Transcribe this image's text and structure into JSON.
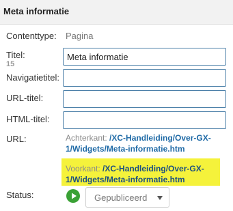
{
  "panel": {
    "title": "Meta informatie"
  },
  "fields": {
    "contenttype": {
      "label": "Contenttype:",
      "value": "Pagina"
    },
    "titel": {
      "label": "Titel:",
      "counter": "15",
      "value": "Meta informatie"
    },
    "navigatietitel": {
      "label": "Navigatietitel:",
      "value": ""
    },
    "url_titel": {
      "label": "URL-titel:",
      "value": ""
    },
    "html_titel": {
      "label": "HTML-titel:",
      "value": ""
    }
  },
  "url": {
    "label": "URL:",
    "achterkant": {
      "prefix": "Achterkant: ",
      "line1": "/XC-Handleiding/Over-GX-",
      "line2": "1/Widgets/Meta-informatie.htm"
    },
    "voorkant": {
      "prefix": "Voorkant: ",
      "line1": "/XC-Handleiding/Over-GX-",
      "line2": "1/Widgets/Meta-informatie.htm"
    },
    "highlight_color": "#f5f23b",
    "link_color": "#1f6aa6"
  },
  "status": {
    "label": "Status:",
    "play_icon": "play-icon",
    "play_color": "#3aa135",
    "selected": "Gepubliceerd"
  }
}
